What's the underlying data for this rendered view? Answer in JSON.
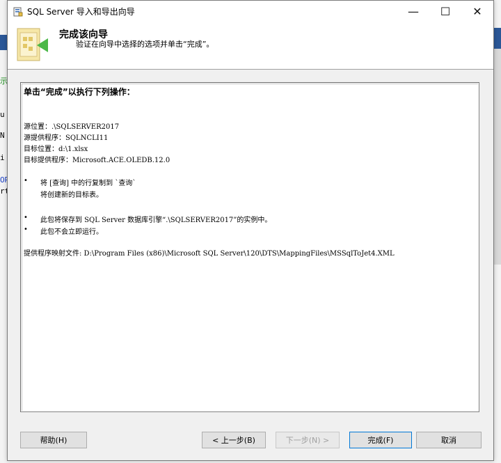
{
  "window": {
    "title": "SQL Server 导入和导出向导",
    "minimize_glyph": "—",
    "maximize_glyph": "☐",
    "close_glyph": "✕"
  },
  "header": {
    "title": "完成该向导",
    "subtitle": "验证在向导中选择的选项并单击“完成”。"
  },
  "summary": {
    "heading": "单击“完成”以执行下列操作：",
    "lines": [
      "源位置：.\\SQLSERVER2017",
      "源提供程序：SQLNCLI11",
      "目标位置：d:\\1.xlsx",
      "目标提供程序：Microsoft.ACE.OLEDB.12.0"
    ],
    "bullet": "•",
    "bullets": [
      "将 [查询] 中的行复制到 `查询`",
      "将创建新的目标表。",
      "此包将保存到 SQL Server 数据库引擎“.\\SQLSERVER2017”的实例中。",
      "此包不会立即运行。"
    ],
    "mapping": "提供程序映射文件: D:\\Program Files (x86)\\Microsoft SQL Server\\120\\DTS\\MappingFiles\\MSSqlToJet4.XML"
  },
  "buttons": {
    "help": "帮助(H)",
    "back": "< 上一步(B)",
    "next": "下一步(N) >",
    "finish": "完成(F)",
    "cancel": "取消"
  },
  "background": {
    "glyphs": [
      "示",
      "u",
      "N",
      "i",
      "OR",
      "rt"
    ]
  },
  "colors": {
    "background_accent": "#2b5797",
    "focus_border": "#0078d7"
  },
  "icons": {
    "app": "sql-server-wizard-icon",
    "header": "wizard-arrow-icon"
  }
}
